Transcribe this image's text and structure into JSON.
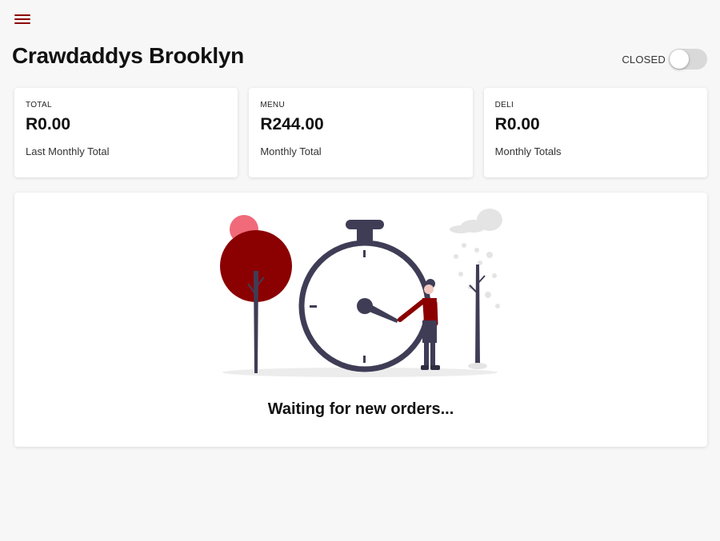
{
  "header": {
    "menu_icon": "hamburger-menu-icon",
    "title": "Crawdaddys Brooklyn",
    "status_label": "CLOSED",
    "status_on": false
  },
  "cards": [
    {
      "label": "TOTAL",
      "value": "R0.00",
      "sub": "Last Monthly Total"
    },
    {
      "label": "MENU",
      "value": "R244.00",
      "sub": "Monthly Total"
    },
    {
      "label": "DELI",
      "value": "R0.00",
      "sub": "Monthly Totals"
    }
  ],
  "panel": {
    "illustration": "waiting-clock-illustration",
    "message": "Waiting for new orders..."
  },
  "colors": {
    "accent": "#8b0a0a",
    "accent_light": "#f06a7a",
    "dark": "#3f3d56",
    "background": "#f7f7f7"
  }
}
